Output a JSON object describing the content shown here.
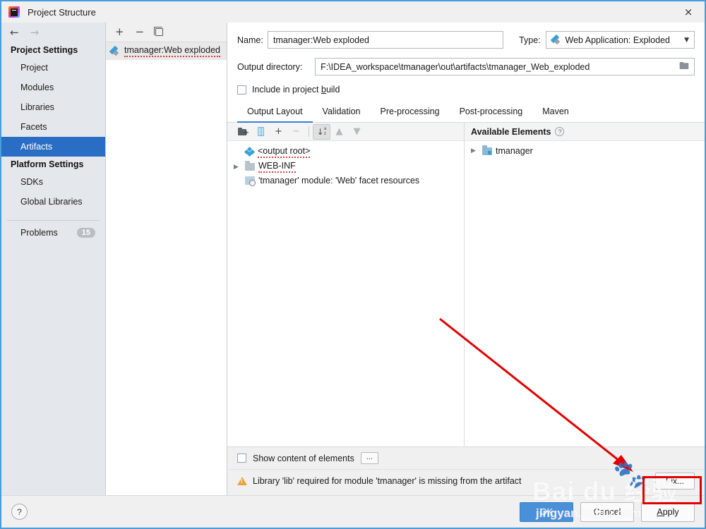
{
  "window": {
    "title": "Project Structure",
    "app_icon": "intellij-idea-icon",
    "close_label": "×"
  },
  "sidebar": {
    "nav": {
      "back": "←",
      "forward": "→"
    },
    "groups": [
      {
        "label": "Project Settings",
        "items": [
          {
            "label": "Project",
            "selected": false
          },
          {
            "label": "Modules",
            "selected": false
          },
          {
            "label": "Libraries",
            "selected": false
          },
          {
            "label": "Facets",
            "selected": false
          },
          {
            "label": "Artifacts",
            "selected": true
          }
        ]
      },
      {
        "label": "Platform Settings",
        "items": [
          {
            "label": "SDKs",
            "selected": false
          },
          {
            "label": "Global Libraries",
            "selected": false
          }
        ]
      }
    ],
    "problems": {
      "label": "Problems",
      "count": "15"
    }
  },
  "artifacts": {
    "toolbar": {
      "add": "+",
      "remove": "−",
      "copy_icon": "copy-icon"
    },
    "items": [
      {
        "label": "tmanager:Web exploded",
        "has_error": true
      }
    ]
  },
  "details": {
    "name_label": "Name:",
    "name_value": "tmanager:Web exploded",
    "type_label": "Type:",
    "type_value": "Web Application: Exploded",
    "output_dir_label": "Output directory:",
    "output_dir_value": "F:\\IDEA_workspace\\tmanager\\out\\artifacts\\tmanager_Web_exploded",
    "include_in_build_label": "Include in project build",
    "include_in_build_checked": false,
    "tabs": [
      {
        "label": "Output Layout",
        "active": true
      },
      {
        "label": "Validation",
        "active": false
      },
      {
        "label": "Pre-processing",
        "active": false
      },
      {
        "label": "Post-processing",
        "active": false
      },
      {
        "label": "Maven",
        "active": false
      }
    ]
  },
  "output_layout": {
    "toolbar": {
      "add_folder": "add-folder-icon",
      "add_archive": "create-archive-icon",
      "add": "+",
      "remove": "−",
      "sort": "sort-az-icon",
      "move_up": "▲",
      "move_down": "▼"
    },
    "tree": [
      {
        "label": "<output root>",
        "icon": "output-root-icon",
        "expander": "",
        "has_error": true,
        "indent": 0
      },
      {
        "label": "WEB-INF",
        "icon": "folder-icon",
        "expander": "▶",
        "has_error": true,
        "indent": 1
      },
      {
        "label": "'tmanager' module: 'Web' facet resources",
        "icon": "module-facet-icon",
        "expander": "",
        "has_error": false,
        "indent": 1
      }
    ]
  },
  "available_elements": {
    "title": "Available Elements",
    "help_icon": "help-icon",
    "tree": [
      {
        "label": "tmanager",
        "icon": "module-folder-icon",
        "expander": "▶"
      }
    ]
  },
  "bottom": {
    "show_content_label": "Show content of elements",
    "show_content_checked": false,
    "more_button": "...",
    "warning_icon": "warning-icon",
    "warning_text": "Library 'lib' required for module 'tmanager' is missing from the artifact",
    "fix_button": "Fix..."
  },
  "footer": {
    "help_button": "?",
    "ok_button": "OK",
    "cancel_button": "Cancel",
    "apply_button": "Apply"
  },
  "annotations": {
    "arrow": "red-arrow-pointing-to-fix-button",
    "highlight": "red-box-around-fix-button"
  },
  "watermark": {
    "main": "Bai du",
    "cn": "经验",
    "sub": "jingyan.baidu.com"
  },
  "colors": {
    "accent": "#2a6dc4",
    "selection": "#2a6dc4",
    "tab_active": "#3a7fd5",
    "warning": "#e8a33d",
    "error": "#d04040",
    "annotation": "#e00000",
    "window_border": "#4a9cdb"
  }
}
